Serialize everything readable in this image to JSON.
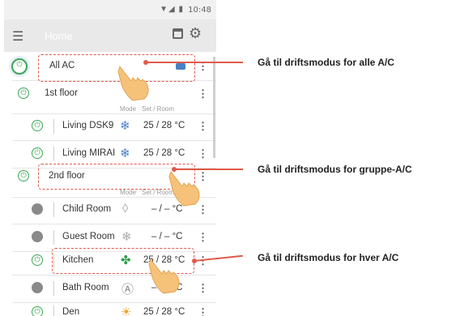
{
  "status_bar": {
    "time": "10:48",
    "icons": "▼◢ ▮"
  },
  "app_bar": {
    "title": "Home",
    "menu_icon": "menu-icon",
    "calendar_icon": "calendar-icon",
    "settings_icon": "gear-icon"
  },
  "columns": {
    "mode": "Mode",
    "set_room": "Set / Room"
  },
  "rows": {
    "all_ac": {
      "name": "All AC"
    },
    "floor1": {
      "name": "1st floor"
    },
    "living_dsk9": {
      "name": "Living DSK9",
      "mode_icon": "❄",
      "value": "25 / 28  °C",
      "power": "on"
    },
    "living_mirai": {
      "name": "Living MIRAI",
      "mode_icon": "❄",
      "value": "25 / 28  °C",
      "power": "on"
    },
    "floor2": {
      "name": "2nd floor"
    },
    "child_room": {
      "name": "Child Room",
      "mode_icon": "◊",
      "value": "– / –   °C",
      "power": "off"
    },
    "guest_room": {
      "name": "Guest Room",
      "mode_icon": "❄",
      "value": "– / –   °C",
      "power": "off"
    },
    "kitchen": {
      "name": "Kitchen",
      "mode_icon": "✤",
      "value": "25 / 28  °C",
      "power": "on"
    },
    "bath_room": {
      "name": "Bath Room",
      "mode_icon": "Ⓐ",
      "value": "– / –   °C",
      "power": "off"
    },
    "den": {
      "name": "Den",
      "mode_icon": "☀",
      "value": "25 / 28  °C",
      "power": "on"
    }
  },
  "callouts": {
    "all": "Gå til driftsmodus for alle A/C",
    "group": "Gå til driftsmodus for gruppe-A/C",
    "each": "Gå til driftsmodus for hver A/C"
  },
  "colors": {
    "power_on": "#3aa655",
    "power_off": "#8a8a8a",
    "callout": "#e05a4a",
    "cool": "#4a7fc4",
    "fan": "#2f9e4a",
    "heat": "#f0a020"
  }
}
